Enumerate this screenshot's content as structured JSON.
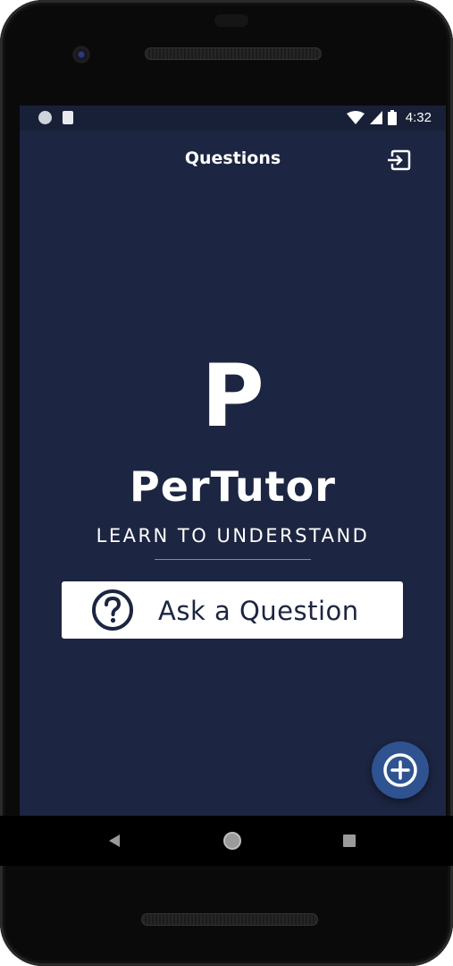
{
  "status_bar": {
    "time": "4:32",
    "left_icons": [
      "record-indicator-icon",
      "sd-card-icon"
    ],
    "right_icons": [
      "wifi-icon",
      "cellular-signal-icon",
      "battery-icon"
    ]
  },
  "app_bar": {
    "title": "Questions",
    "action_icon": "logout-icon"
  },
  "brand": {
    "logo_letter": "P",
    "name": "PerTutor",
    "tagline": "LEARN TO UNDERSTAND"
  },
  "ask_button": {
    "label": "Ask a Question",
    "icon": "question-circle-icon"
  },
  "fab": {
    "icon": "plus-circle-icon"
  },
  "nav_bar": {
    "icons": [
      "back-icon",
      "home-icon",
      "recents-icon"
    ]
  },
  "colors": {
    "background": "#1c2541",
    "status_bar": "#172036",
    "fab": "#2f5290",
    "button_bg": "#ffffff",
    "button_text": "#1c2541"
  }
}
